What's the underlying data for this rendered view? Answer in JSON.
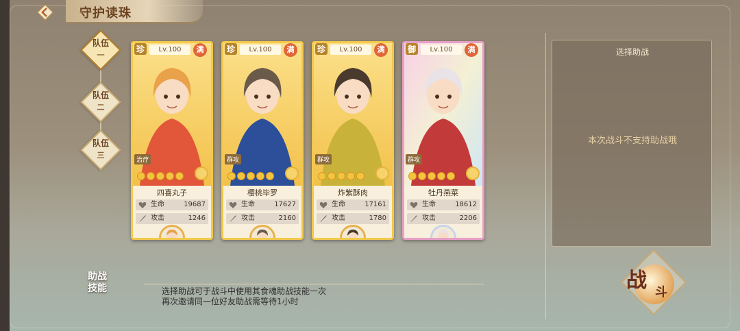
{
  "header": {
    "title": "守护读珠",
    "back_icon": "back-arrow-icon"
  },
  "teams": [
    {
      "label": "队伍",
      "num": "一",
      "active": true
    },
    {
      "label": "队伍",
      "num": "二",
      "active": false
    },
    {
      "label": "队伍",
      "num": "三",
      "active": false
    }
  ],
  "cards": [
    {
      "rank": "珍",
      "level": "Lv.100",
      "max": "满",
      "role": "治疗",
      "name": "四喜丸子",
      "stats": [
        {
          "key": "生命",
          "value": "19687"
        },
        {
          "key": "攻击",
          "value": "1246"
        }
      ],
      "frame": "gold",
      "hair": "#e9a14a",
      "outfit": "#e2563a"
    },
    {
      "rank": "珍",
      "level": "Lv.100",
      "max": "满",
      "role": "群攻",
      "name": "樱桃毕罗",
      "stats": [
        {
          "key": "生命",
          "value": "17627"
        },
        {
          "key": "攻击",
          "value": "2160"
        }
      ],
      "frame": "gold",
      "hair": "#6a5a4a",
      "outfit": "#2d4f9a"
    },
    {
      "rank": "珍",
      "level": "Lv.100",
      "max": "满",
      "role": "群攻",
      "name": "炸紫酥肉",
      "stats": [
        {
          "key": "生命",
          "value": "17161"
        },
        {
          "key": "攻击",
          "value": "1780"
        }
      ],
      "frame": "gold",
      "hair": "#4a3a2e",
      "outfit": "#c9b23a"
    },
    {
      "rank": "御",
      "level": "Lv.100",
      "max": "满",
      "role": "群攻",
      "name": "牡丹燕菜",
      "stats": [
        {
          "key": "生命",
          "value": "18612"
        },
        {
          "key": "攻击",
          "value": "2206"
        }
      ],
      "frame": "rainbow",
      "hair": "#e9e2e6",
      "outfit": "#c23a3a"
    }
  ],
  "assist_panel": {
    "title": "选择助战",
    "message": "本次战斗不支持助战哦"
  },
  "skill": {
    "label_line1": "助战",
    "label_line2": "技能",
    "desc_line1": "选择助战可于战斗中使用其食魂助战技能一次",
    "desc_line2": "再次邀请同一位好友助战需等待1小时"
  },
  "fight_button": {
    "label_main": "战",
    "label_sub": "斗"
  }
}
